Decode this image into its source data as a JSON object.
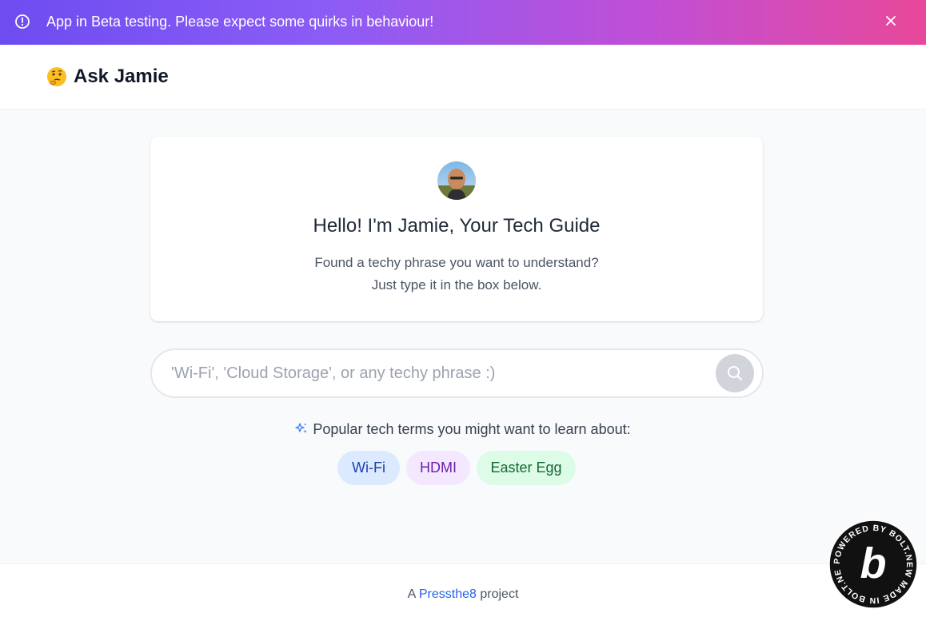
{
  "banner": {
    "text": "App in Beta testing. Please expect some quirks in behaviour!",
    "icon": "alert-circle-icon",
    "close_icon": "close-icon"
  },
  "header": {
    "emoji": "🤔",
    "title": "Ask Jamie"
  },
  "intro": {
    "greeting": "Hello! I'm Jamie, Your Tech Guide",
    "line1": "Found a techy phrase you want to understand?",
    "line2": "Just type it in the box below."
  },
  "search": {
    "placeholder": "'Wi-Fi', 'Cloud Storage', or any techy phrase :)",
    "value": "",
    "icon": "search-icon"
  },
  "popular": {
    "label": "Popular tech terms you might want to learn about:",
    "icon": "sparkle-icon",
    "terms": [
      "Wi-Fi",
      "HDMI",
      "Easter Egg"
    ]
  },
  "footer": {
    "prefix": "A",
    "link": "Pressthe8",
    "suffix": "project"
  },
  "badge": {
    "letter": "b",
    "ring_text": "POWERED BY BOLT.NEW MADE IN BOLT.NEW"
  },
  "colors": {
    "banner_start": "#6d4cf0",
    "banner_end": "#e8489a",
    "link": "#2563eb",
    "chip_wifi_bg": "#dbeafe",
    "chip_hdmi_bg": "#f3e8ff",
    "chip_egg_bg": "#dcfce7"
  }
}
